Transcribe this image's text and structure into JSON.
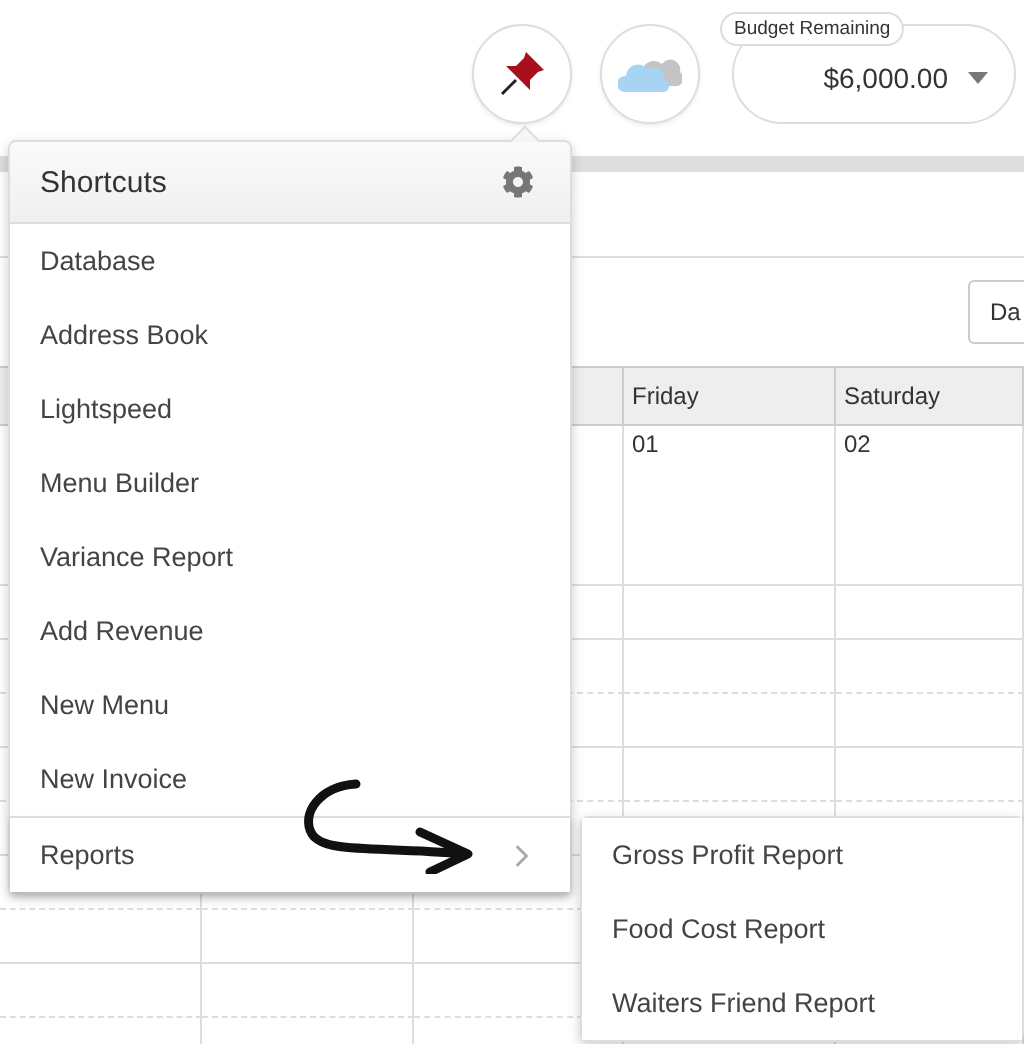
{
  "top_bar": {
    "budget": {
      "label": "Budget Remaining",
      "value": "$6,000.00"
    }
  },
  "calendar": {
    "view_button": "Da",
    "columns": [
      {
        "label": "Friday",
        "date": "01"
      },
      {
        "label": "Saturday",
        "date": "02"
      }
    ]
  },
  "shortcuts": {
    "title": "Shortcuts",
    "items": [
      {
        "label": "Database",
        "kind": "link"
      },
      {
        "label": "Address Book",
        "kind": "link"
      },
      {
        "label": "Lightspeed",
        "kind": "link"
      },
      {
        "label": "Menu Builder",
        "kind": "link"
      },
      {
        "label": "Variance Report",
        "kind": "link"
      },
      {
        "label": "Add Revenue",
        "kind": "link"
      },
      {
        "label": "New Menu",
        "kind": "link"
      },
      {
        "label": "New Invoice",
        "kind": "link"
      },
      {
        "label": "Reports",
        "kind": "submenu",
        "expanded": true,
        "children": [
          {
            "label": "Gross Profit Report"
          },
          {
            "label": "Food Cost Report"
          },
          {
            "label": "Waiters Friend Report"
          }
        ]
      }
    ]
  }
}
